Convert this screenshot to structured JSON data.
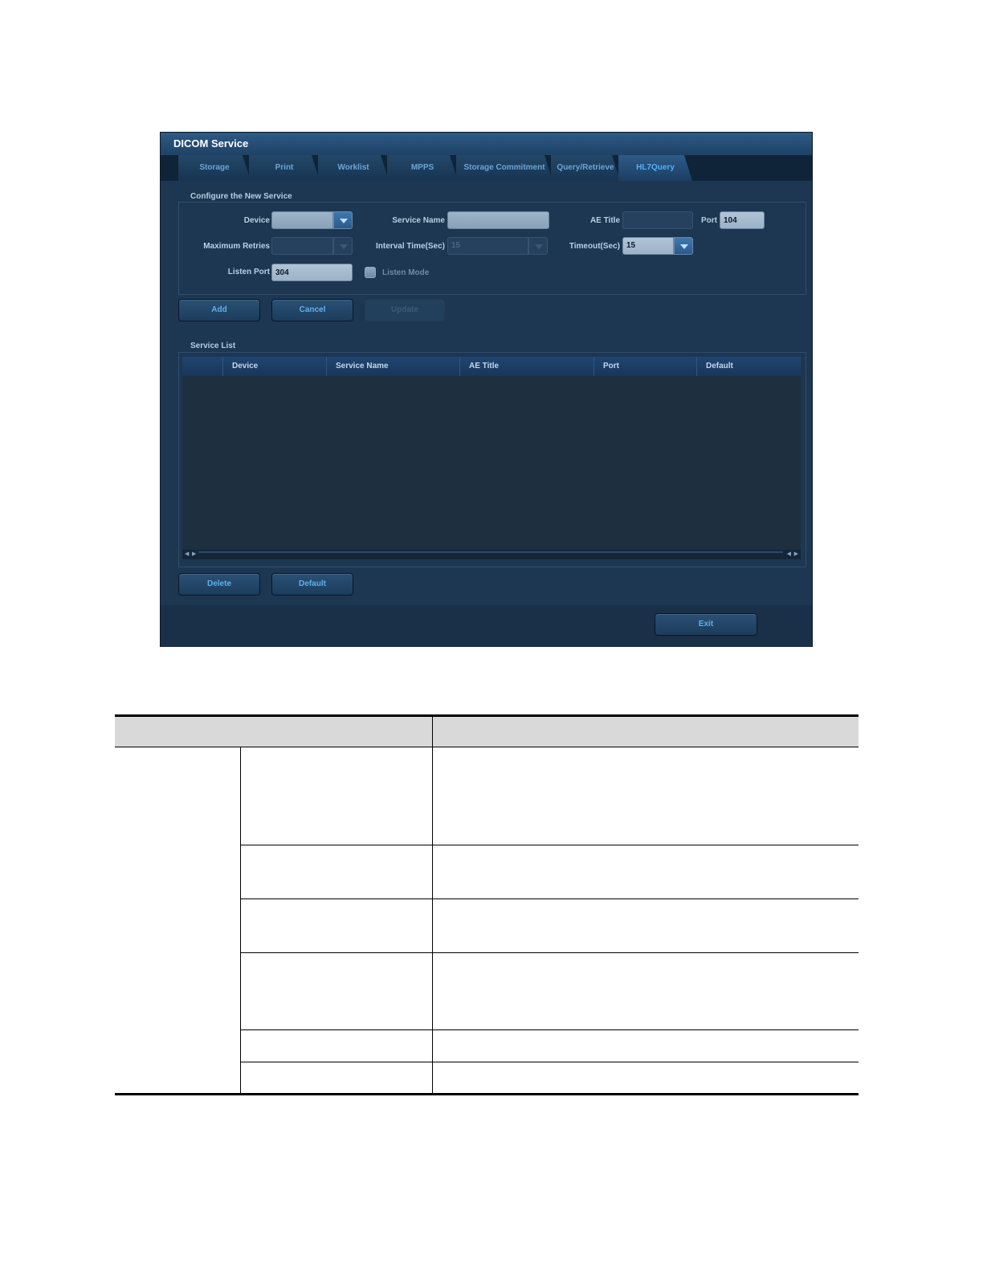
{
  "dialog": {
    "title": "DICOM Service",
    "tabs": [
      {
        "label": "Storage",
        "active": false
      },
      {
        "label": "Print",
        "active": false
      },
      {
        "label": "Worklist",
        "active": false
      },
      {
        "label": "MPPS",
        "active": false
      },
      {
        "label": "Storage Commitment",
        "active": false
      },
      {
        "label": "Query/Retrieve",
        "active": false
      },
      {
        "label": "HL7Query",
        "active": true
      }
    ],
    "config_group": {
      "title": "Configure the New Service",
      "device_label": "Device",
      "device_value": "",
      "service_name_label": "Service Name",
      "service_name_value": "",
      "ae_title_label": "AE Title",
      "ae_title_value": "",
      "port_label": "Port",
      "port_value": "104",
      "max_retries_label": "Maximum Retries",
      "max_retries_value": "",
      "interval_label": "Interval Time(Sec)",
      "interval_value": "15",
      "timeout_label": "Timeout(Sec)",
      "timeout_value": "15",
      "listen_port_label": "Listen Port",
      "listen_port_value": "304",
      "listen_mode_label": "Listen Mode",
      "listen_mode_checked": false
    },
    "buttons": {
      "add": "Add",
      "cancel": "Cancel",
      "update": "Update",
      "delete": "Delete",
      "default": "Default",
      "exit": "Exit"
    },
    "service_list": {
      "title": "Service List",
      "columns": [
        "Device",
        "Service Name",
        "AE Title",
        "Port",
        "Default"
      ],
      "rows": []
    }
  },
  "colors": {
    "dialog_bg": "#1a3048",
    "accent_text": "#5fb1f0",
    "active_tab_text": "#4fb0ff"
  }
}
